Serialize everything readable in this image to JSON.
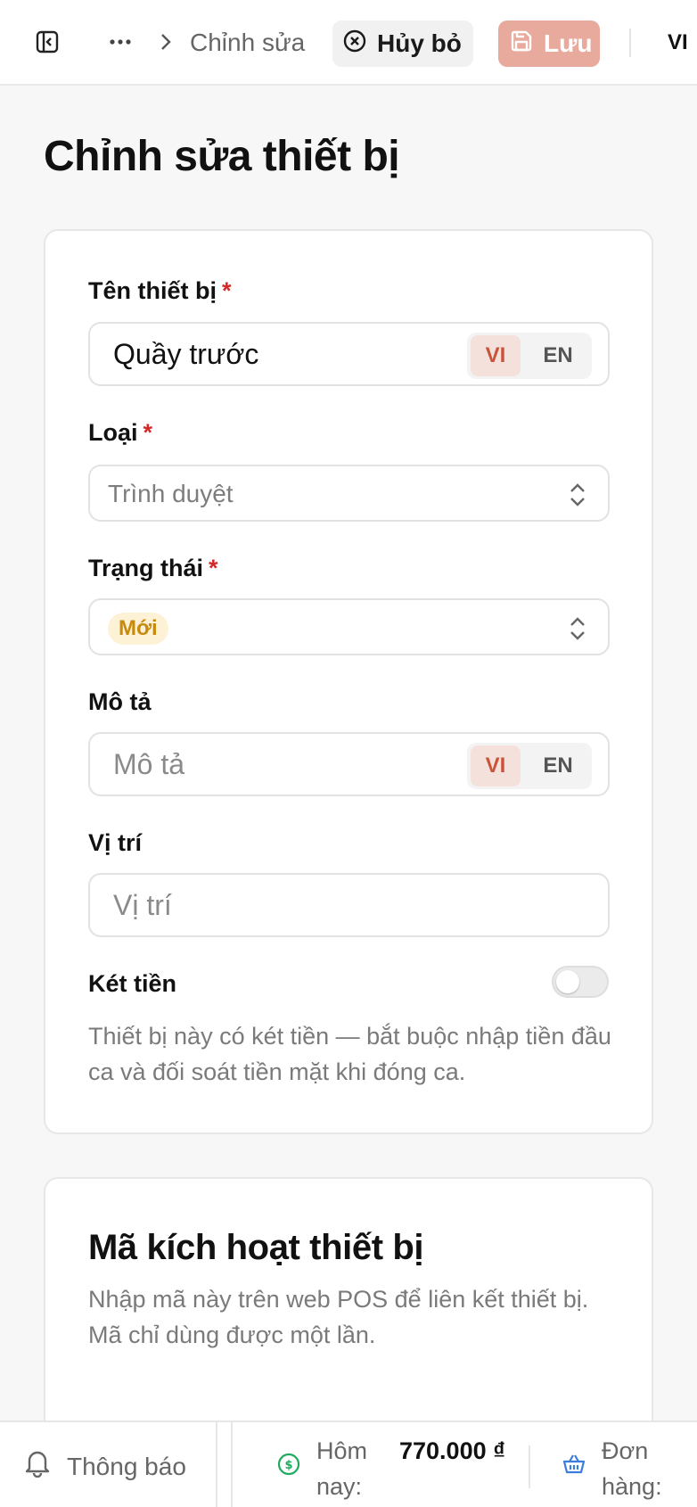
{
  "topbar": {
    "breadcrumb_current": "Chỉnh sửa",
    "cancel_label": "Hủy bỏ",
    "save_label": "Lưu",
    "language": "VI"
  },
  "page": {
    "title": "Chỉnh sửa thiết bị"
  },
  "form": {
    "name": {
      "label": "Tên thiết bị",
      "required_mark": "*",
      "value": "Quầy trước",
      "lang_options": [
        "VI",
        "EN"
      ],
      "active_lang": "VI"
    },
    "type": {
      "label": "Loại",
      "required_mark": "*",
      "value": "Trình duyệt"
    },
    "status": {
      "label": "Trạng thái",
      "required_mark": "*",
      "value": "Mới"
    },
    "description": {
      "label": "Mô tả",
      "placeholder": "Mô tả",
      "lang_options": [
        "VI",
        "EN"
      ],
      "active_lang": "VI"
    },
    "location": {
      "label": "Vị trí",
      "placeholder": "Vị trí"
    },
    "cash_drawer": {
      "label": "Két tiền",
      "enabled": false,
      "help": "Thiết bị này có két tiền — bắt buộc nhập tiền đầu ca và đối soát tiền mặt khi đóng ca."
    }
  },
  "activation": {
    "title": "Mã kích hoạt thiết bị",
    "description": "Nhập mã này trên web POS để liên kết thiết bị. Mã chỉ dùng được một lần."
  },
  "bottombar": {
    "notifications_label": "Thông báo",
    "today_label": "Hôm nay:",
    "today_value": "770.000 ₫",
    "orders_label": "Đơn hàng:"
  },
  "colors": {
    "accent": "#c8543c",
    "save_button_disabled": "#e8aa9c",
    "badge_bg": "#fdf1d6",
    "badge_text": "#c88a0c",
    "required": "#d62828",
    "money_icon": "#1fab5e",
    "orders_icon": "#3b7ddd"
  }
}
